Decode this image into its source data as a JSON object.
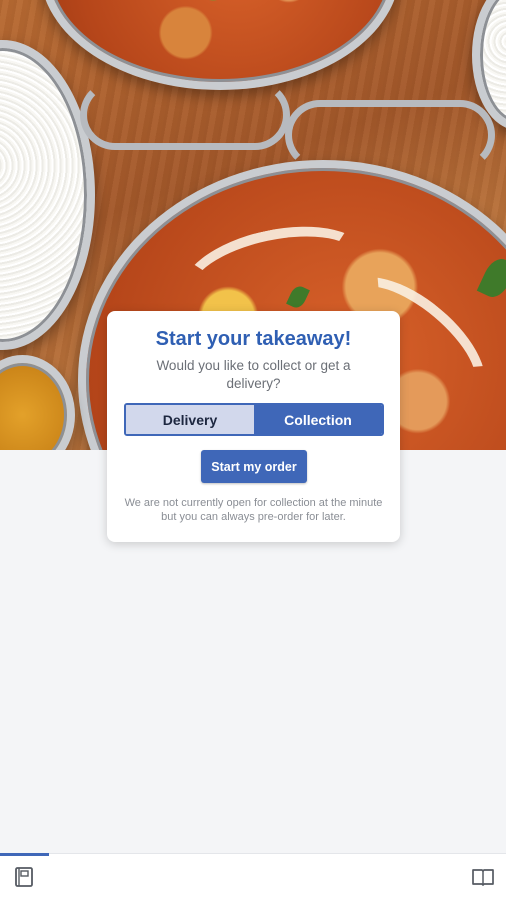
{
  "card": {
    "title": "Start your takeaway!",
    "subtitle": "Would you like to collect or get a delivery?",
    "options": [
      {
        "label": "Delivery",
        "selected": false
      },
      {
        "label": "Collection",
        "selected": true
      }
    ],
    "start_button_label": "Start my order",
    "note": "We are not currently open for collection at the minute but you can always pre-order for later."
  },
  "bottom_nav": {
    "left_icon": "menu-book-icon",
    "right_icon": "open-book-icon",
    "active_index": 0
  },
  "colors": {
    "accent": "#3f67b8",
    "title": "#2f5fb3",
    "toggle_inactive_bg": "#d2d8ec",
    "page_bg": "#f4f5f7"
  }
}
